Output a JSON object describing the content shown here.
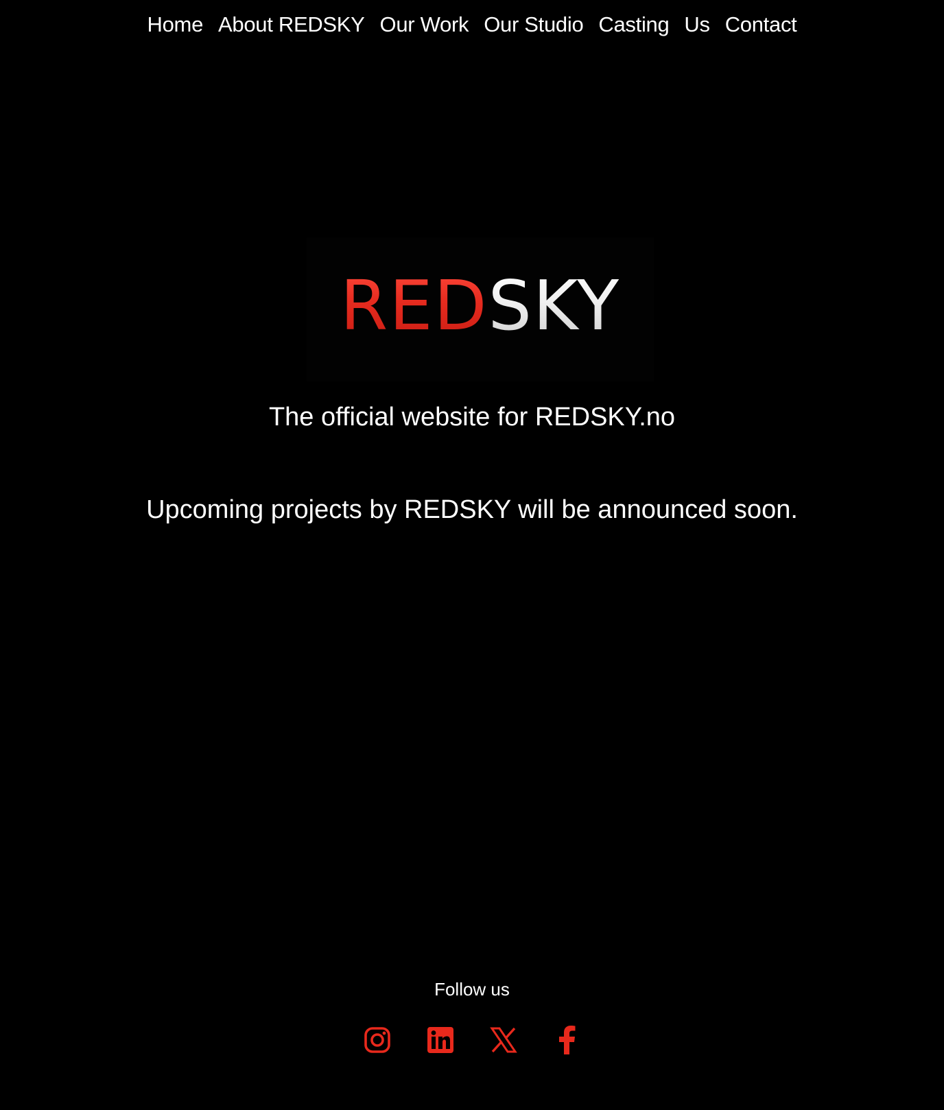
{
  "nav": {
    "items": [
      {
        "label": "Home"
      },
      {
        "label": "About REDSKY"
      },
      {
        "label": "Our Work"
      },
      {
        "label": "Our Studio"
      },
      {
        "label": "Casting"
      },
      {
        "label": "Us"
      },
      {
        "label": "Contact"
      }
    ]
  },
  "logo": {
    "red_part": "RED",
    "white_part": "SKY",
    "red_color": "#e62b1f"
  },
  "main": {
    "tagline": "The official website for REDSKY.no",
    "announcement": "Upcoming projects by REDSKY will be announced soon."
  },
  "footer": {
    "follow_label": "Follow us",
    "social": [
      {
        "icon": "instagram-icon"
      },
      {
        "icon": "linkedin-icon"
      },
      {
        "icon": "x-icon"
      },
      {
        "icon": "facebook-icon"
      }
    ],
    "icon_color": "#e8291c"
  }
}
